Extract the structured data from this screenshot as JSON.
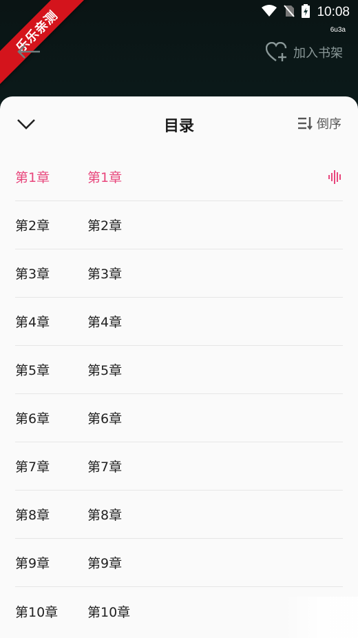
{
  "status_bar": {
    "time": "10:08",
    "sub_label": "6u3a"
  },
  "ribbon": {
    "text": "乐乐亲测"
  },
  "header": {
    "add_to_shelf": "加入书架"
  },
  "sheet": {
    "title": "目录",
    "sort_label": "倒序",
    "active_color": "#e8467c",
    "chapters": [
      {
        "num": "第1章",
        "name": "第1章",
        "active": true
      },
      {
        "num": "第2章",
        "name": "第2章"
      },
      {
        "num": "第3章",
        "name": "第3章"
      },
      {
        "num": "第4章",
        "name": "第4章"
      },
      {
        "num": "第5章",
        "name": "第5章"
      },
      {
        "num": "第6章",
        "name": "第6章"
      },
      {
        "num": "第7章",
        "name": "第7章"
      },
      {
        "num": "第8章",
        "name": "第8章"
      },
      {
        "num": "第9章",
        "name": "第9章"
      },
      {
        "num": "第10章",
        "name": "第10章"
      }
    ]
  }
}
